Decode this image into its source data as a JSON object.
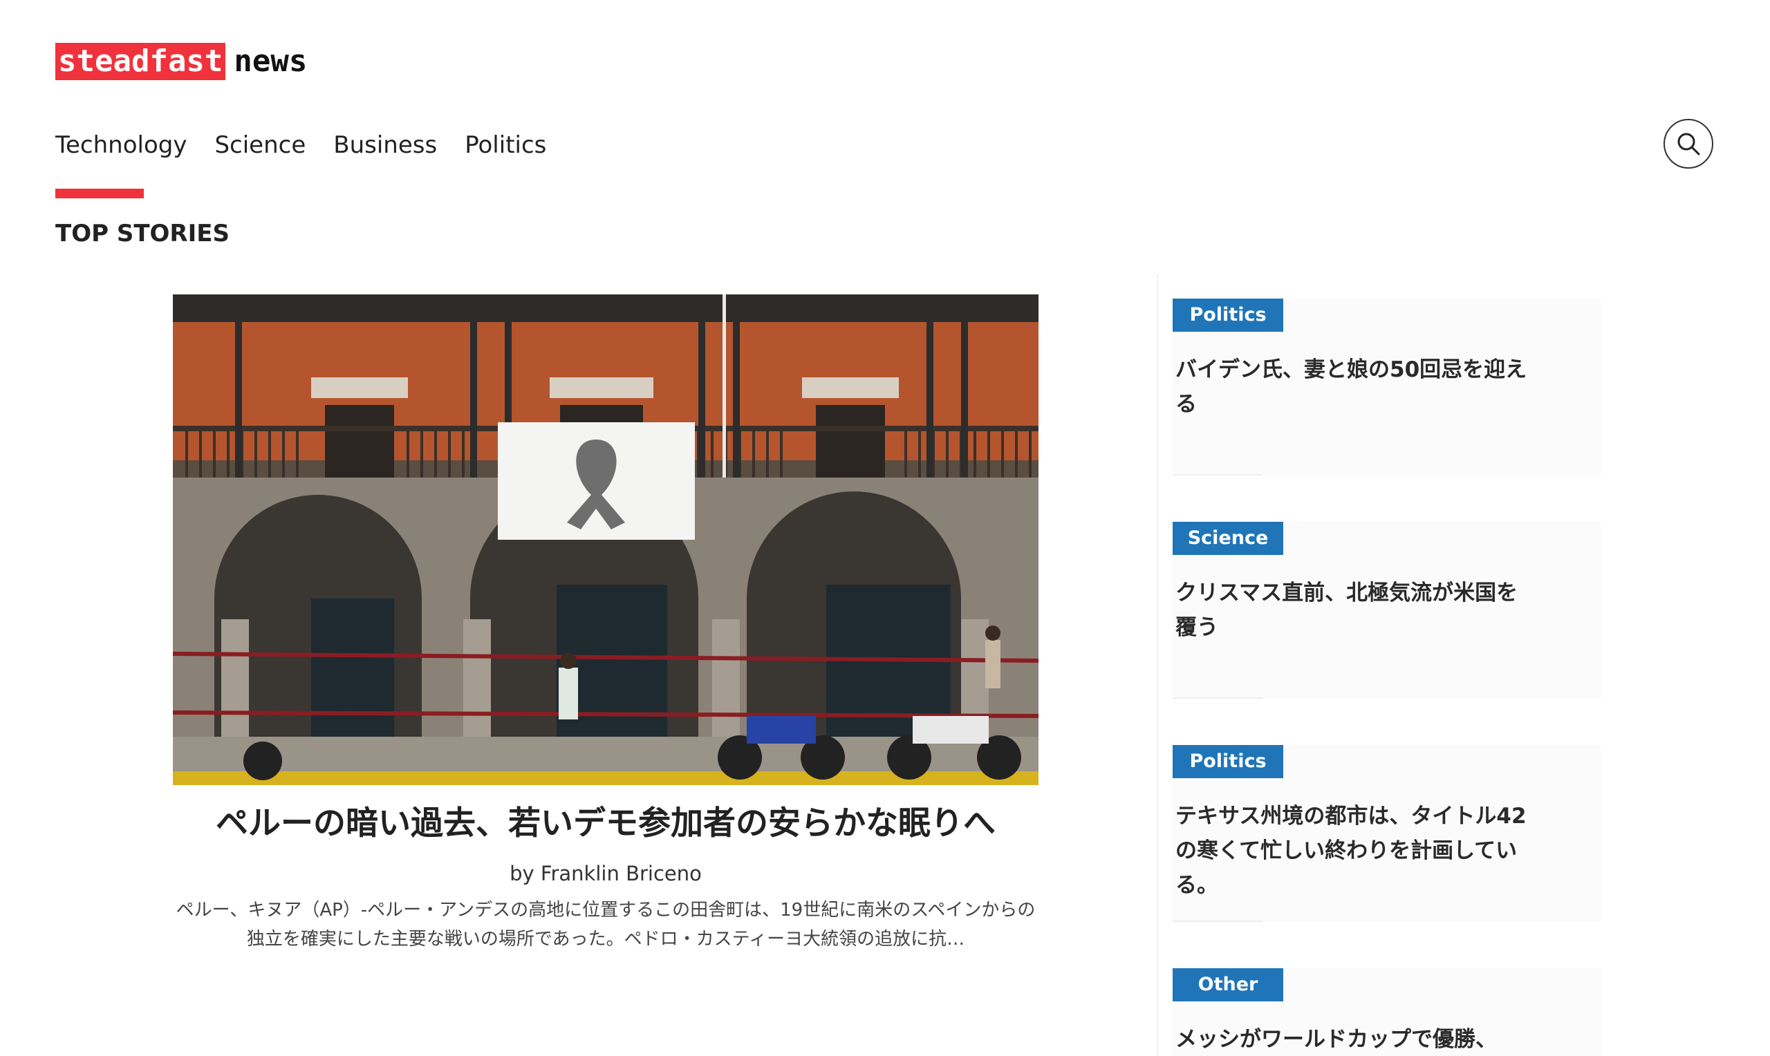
{
  "brand": {
    "logo_highlight": "steadfast",
    "logo_rest": "news",
    "accent_color": "#f0323c"
  },
  "nav": {
    "items": [
      {
        "label": "Technology"
      },
      {
        "label": "Science"
      },
      {
        "label": "Business"
      },
      {
        "label": "Politics"
      }
    ],
    "search_icon": "search-icon"
  },
  "section": {
    "title": "TOP STORIES"
  },
  "main_story": {
    "image_description_icon": "photo",
    "title": "ペルーの暗い過去、若いデモ参加者の安らかな眠りへ",
    "byline": "by Franklin Briceno",
    "excerpt": "ペルー、キヌア（AP）-ペルー・アンデスの高地に位置するこの田舎町は、19世紀に南米のスペインからの独立を確実にした主要な戦いの場所であった。ペドロ・カスティーヨ大統領の追放に抗…"
  },
  "sidebar": {
    "badge_color": "#1f75b8",
    "stories": [
      {
        "category": "Politics",
        "title": "バイデン氏、妻と娘の50回忌を迎える"
      },
      {
        "category": "Science",
        "title": "クリスマス直前、北極気流が米国を覆う"
      },
      {
        "category": "Politics",
        "title": "テキサス州境の都市は、タイトル42の寒くて忙しい終わりを計画している。"
      },
      {
        "category": "Other",
        "title": "メッシがワールドカップで優勝、"
      }
    ]
  }
}
